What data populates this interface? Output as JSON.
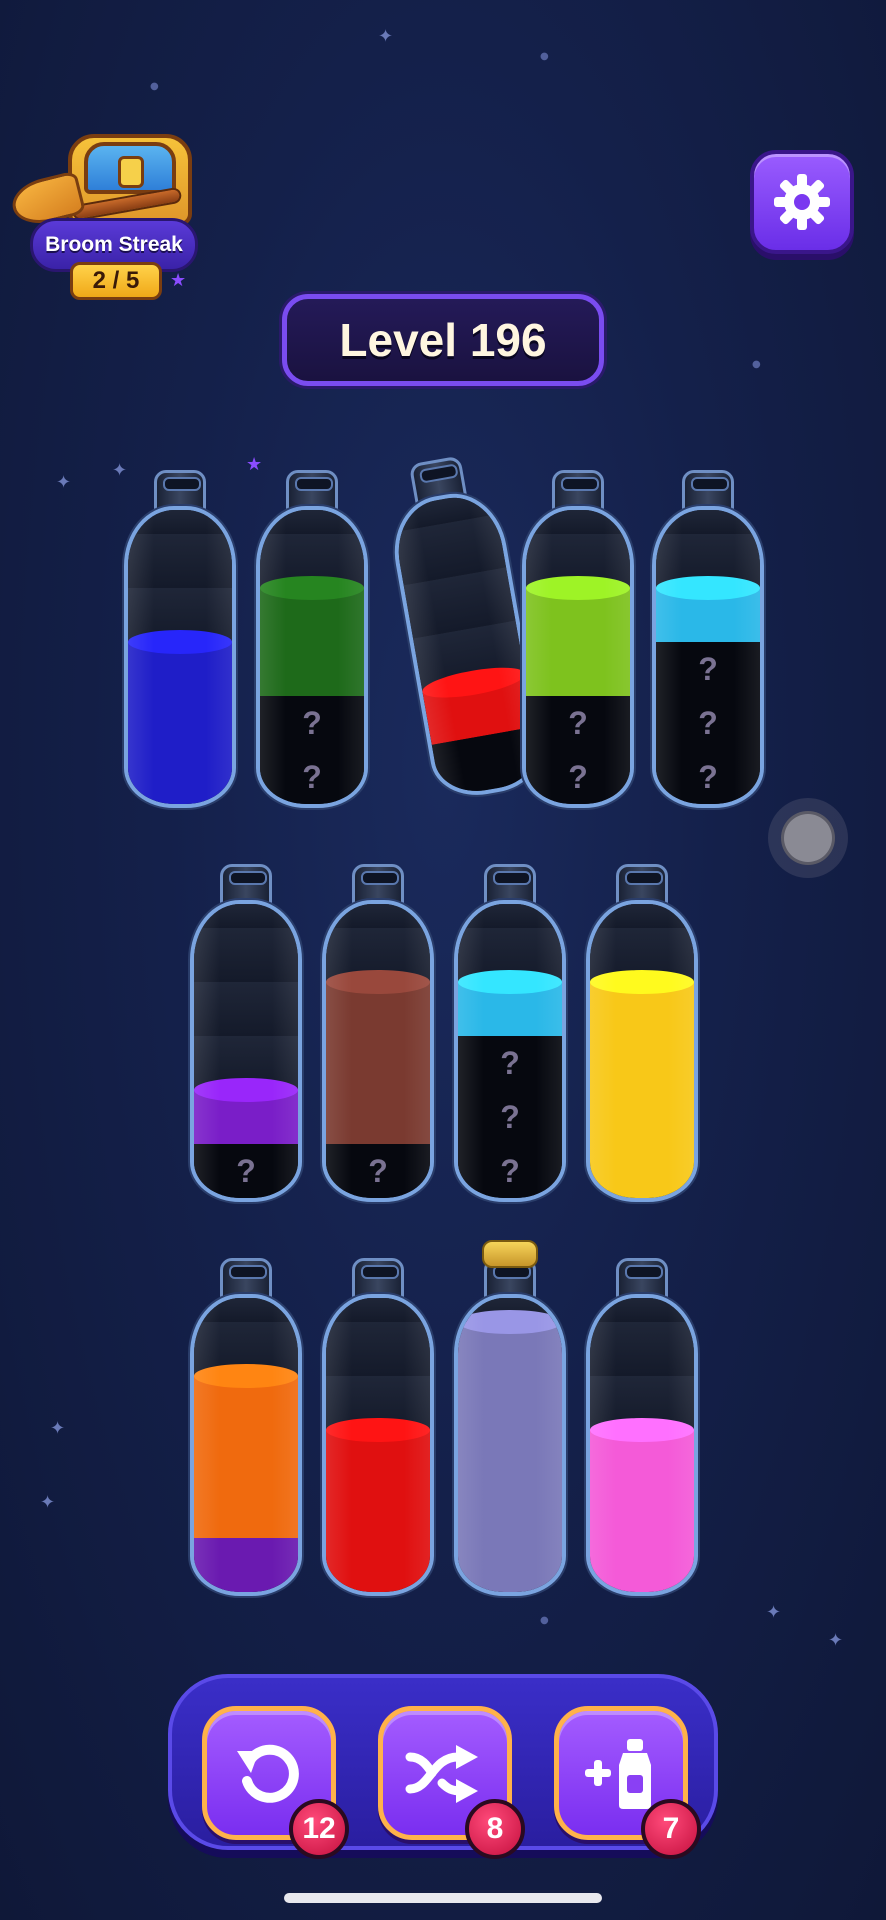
{
  "streak": {
    "title": "Broom Streak",
    "count": "2 / 5",
    "icon": "treasure-chest-icon"
  },
  "settings": {
    "icon": "gear-icon"
  },
  "level": {
    "label": "Level 196"
  },
  "hidden_mark": "?",
  "bottles": [
    {
      "row": 1,
      "col": 1,
      "segments": [
        "empty",
        "empty",
        "blue",
        "blue",
        "blue"
      ]
    },
    {
      "row": 1,
      "col": 2,
      "segments": [
        "empty",
        "green",
        "green",
        "hidden",
        "hidden"
      ]
    },
    {
      "row": 1,
      "col": 3,
      "tilted": true,
      "segments": [
        "empty",
        "empty",
        "empty",
        "red",
        "empty-dark"
      ]
    },
    {
      "row": 1,
      "col": 4,
      "segments": [
        "empty",
        "lime",
        "lime",
        "hidden",
        "hidden"
      ]
    },
    {
      "row": 1,
      "col": 5,
      "segments": [
        "empty",
        "cyan",
        "hidden",
        "hidden",
        "hidden"
      ]
    },
    {
      "row": 2,
      "col": 1,
      "segments": [
        "empty",
        "empty",
        "empty",
        "purple",
        "hidden"
      ]
    },
    {
      "row": 2,
      "col": 2,
      "segments": [
        "empty",
        "brown",
        "brown",
        "brown",
        "hidden"
      ]
    },
    {
      "row": 2,
      "col": 3,
      "segments": [
        "empty",
        "cyan",
        "hidden",
        "hidden",
        "hidden"
      ]
    },
    {
      "row": 2,
      "col": 4,
      "segments": [
        "empty",
        "yellow",
        "yellow",
        "yellow",
        "yellow"
      ]
    },
    {
      "row": 3,
      "col": 1,
      "segments": [
        "empty",
        "orange",
        "orange",
        "orange",
        "violet"
      ]
    },
    {
      "row": 3,
      "col": 2,
      "segments": [
        "empty",
        "empty",
        "red",
        "red",
        "red"
      ]
    },
    {
      "row": 3,
      "col": 3,
      "corked": true,
      "segments": [
        "lavender",
        "lavender",
        "lavender",
        "lavender",
        "lavender"
      ]
    },
    {
      "row": 3,
      "col": 4,
      "segments": [
        "empty",
        "empty",
        "pink",
        "pink",
        "pink"
      ]
    }
  ],
  "colors": {
    "blue": "#1f1ec8",
    "green": "#1e6a1a",
    "red": "#e01010",
    "lime": "#7ec21e",
    "cyan": "#2ab8e8",
    "purple": "#7a1ec8",
    "brown": "#7a3a30",
    "yellow": "#f8c818",
    "orange": "#f06a0e",
    "violet": "#6a1ab0",
    "lavender": "#7a78b8",
    "pink": "#f45ad8"
  },
  "toolbar": {
    "undo": {
      "icon": "undo-icon",
      "count": "12"
    },
    "shuffle": {
      "icon": "shuffle-icon",
      "count": "8"
    },
    "add_bottle": {
      "icon": "add-bottle-icon",
      "count": "7"
    }
  }
}
